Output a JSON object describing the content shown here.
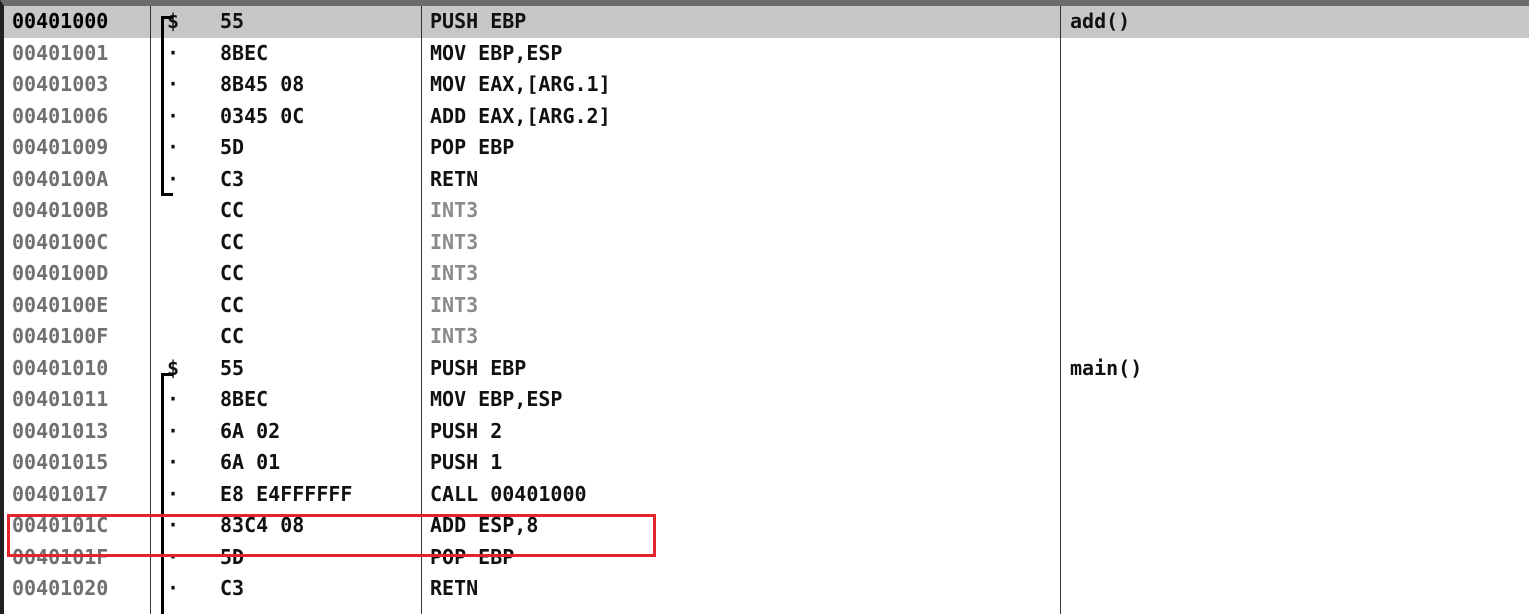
{
  "rows": [
    {
      "addr": "00401000",
      "sym": "$",
      "hex": "55",
      "instr": "PUSH EBP",
      "comment": "add()",
      "selected": true
    },
    {
      "addr": "00401001",
      "sym": "·",
      "hex": "8BEC",
      "instr": "MOV EBP,ESP",
      "comment": ""
    },
    {
      "addr": "00401003",
      "sym": "·",
      "hex": "8B45 08",
      "instr": "MOV EAX,[ARG.1]",
      "comment": ""
    },
    {
      "addr": "00401006",
      "sym": "·",
      "hex": "0345 0C",
      "instr": "ADD EAX,[ARG.2]",
      "comment": ""
    },
    {
      "addr": "00401009",
      "sym": "·",
      "hex": "5D",
      "instr": "POP EBP",
      "comment": ""
    },
    {
      "addr": "0040100A",
      "sym": "·",
      "hex": "C3",
      "instr": "RETN",
      "comment": ""
    },
    {
      "addr": "0040100B",
      "sym": "",
      "hex": "CC",
      "instr": "INT3",
      "comment": "",
      "dim": true
    },
    {
      "addr": "0040100C",
      "sym": "",
      "hex": "CC",
      "instr": "INT3",
      "comment": "",
      "dim": true
    },
    {
      "addr": "0040100D",
      "sym": "",
      "hex": "CC",
      "instr": "INT3",
      "comment": "",
      "dim": true
    },
    {
      "addr": "0040100E",
      "sym": "",
      "hex": "CC",
      "instr": "INT3",
      "comment": "",
      "dim": true
    },
    {
      "addr": "0040100F",
      "sym": "",
      "hex": "CC",
      "instr": "INT3",
      "comment": "",
      "dim": true
    },
    {
      "addr": "00401010",
      "sym": "$",
      "hex": "55",
      "instr": "PUSH EBP",
      "comment": "main()"
    },
    {
      "addr": "00401011",
      "sym": "·",
      "hex": "8BEC",
      "instr": "MOV EBP,ESP",
      "comment": ""
    },
    {
      "addr": "00401013",
      "sym": "·",
      "hex": "6A 02",
      "instr": "PUSH 2",
      "comment": ""
    },
    {
      "addr": "00401015",
      "sym": "·",
      "hex": "6A 01",
      "instr": "PUSH 1",
      "comment": ""
    },
    {
      "addr": "00401017",
      "sym": "·",
      "hex": "E8 E4FFFFFF",
      "instr": "CALL 00401000",
      "comment": ""
    },
    {
      "addr": "0040101C",
      "sym": "·",
      "hex": "83C4 08",
      "instr": "ADD ESP,8",
      "comment": "",
      "highlighted": true
    },
    {
      "addr": "0040101F",
      "sym": "·",
      "hex": "5D",
      "instr": "POP EBP",
      "comment": ""
    },
    {
      "addr": "00401020",
      "sym": "·",
      "hex": "C3",
      "instr": "RETN",
      "comment": ""
    }
  ],
  "colors": {
    "selected_row": "#c7c7c7",
    "highlight_border": "#e3242b",
    "address_text": "#707070",
    "int3_text": "#8a8a8a"
  }
}
